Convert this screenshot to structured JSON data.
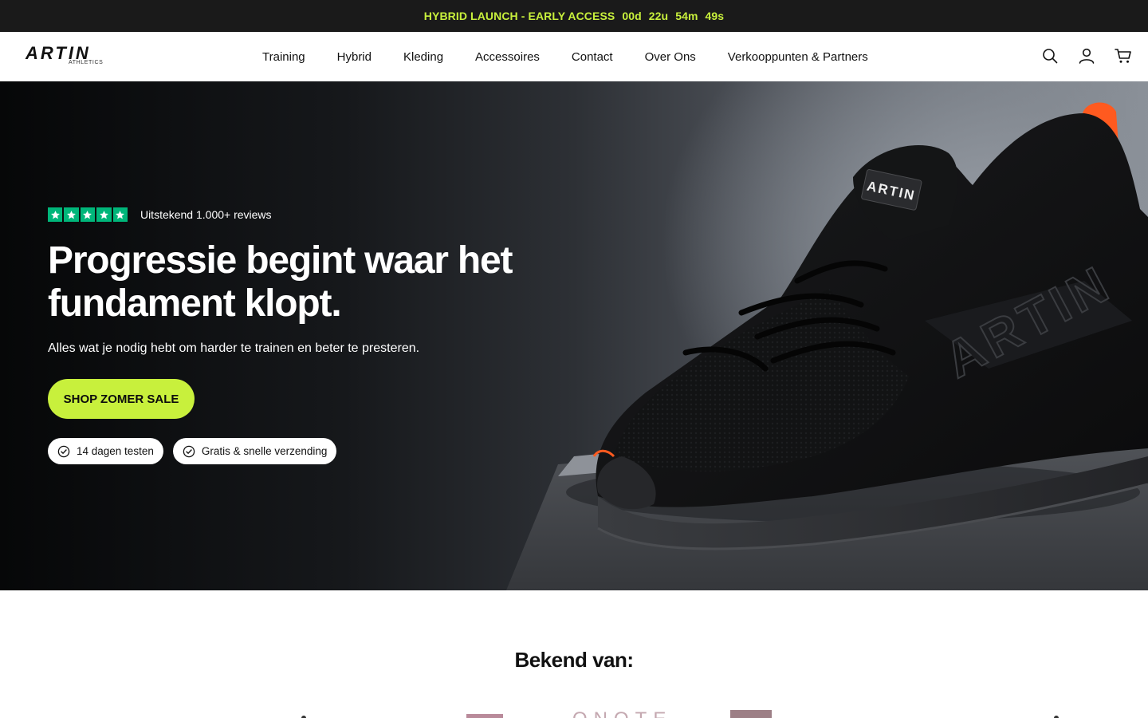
{
  "announcement": {
    "text": "HYBRID LAUNCH - EARLY ACCESS",
    "countdown": {
      "days": "00d",
      "hours": "22u",
      "minutes": "54m",
      "seconds": "49s"
    }
  },
  "brand": {
    "name": "ARTIN",
    "sub": "ATHLETICS"
  },
  "nav": [
    {
      "label": "Training"
    },
    {
      "label": "Hybrid"
    },
    {
      "label": "Kleding"
    },
    {
      "label": "Accessoires"
    },
    {
      "label": "Contact"
    },
    {
      "label": "Over Ons"
    },
    {
      "label": "Verkooppunten & Partners"
    }
  ],
  "header_icons": [
    "search-icon",
    "account-icon",
    "cart-icon"
  ],
  "hero": {
    "rating": {
      "stars": 5,
      "text": "Uitstekend 1.000+ reviews"
    },
    "headline": "Progressie begint waar het fundament klopt.",
    "subline": "Alles wat je nodig hebt om harder te trainen en beter te presteren.",
    "cta_label": "SHOP ZOMER SALE",
    "badges": [
      {
        "label": "14 dagen testen"
      },
      {
        "label": "Gratis & snelle verzending"
      }
    ],
    "shoe_logo_text": "ARTIN"
  },
  "press": {
    "title": "Bekend van:",
    "logos": [
      "ONOTE"
    ]
  },
  "colors": {
    "accent": "#c8f03c",
    "announce_bg": "#1a1a1a",
    "trustpilot": "#00b67a",
    "shoe_pull_tab": "#ff5a1f"
  }
}
